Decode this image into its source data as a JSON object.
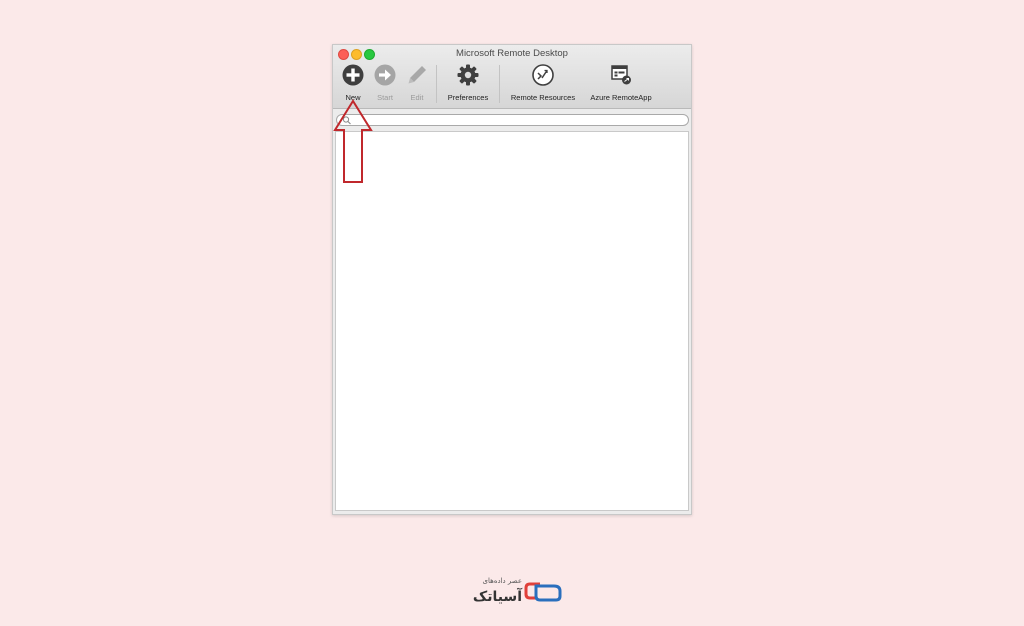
{
  "window": {
    "title": "Microsoft Remote Desktop"
  },
  "toolbar": {
    "new_label": "New",
    "start_label": "Start",
    "edit_label": "Edit",
    "preferences_label": "Preferences",
    "remote_resources_label": "Remote Resources",
    "azure_remoteapp_label": "Azure RemoteApp"
  },
  "search": {
    "placeholder": ""
  },
  "icons": {
    "new": "plus-circle-icon",
    "start": "arrow-right-circle-icon",
    "edit": "pencil-icon",
    "preferences": "gear-icon",
    "remote_resources": "remote-resources-icon",
    "azure_remoteapp": "azure-remoteapp-icon"
  },
  "annotation": {
    "type": "red outline arrow pointing up at New button",
    "color": "#c0282c"
  },
  "logo": {
    "tagline": "عصر داده‌های",
    "name": "آسیاتک",
    "colors": [
      "#e0403a",
      "#2a6fbd"
    ]
  }
}
